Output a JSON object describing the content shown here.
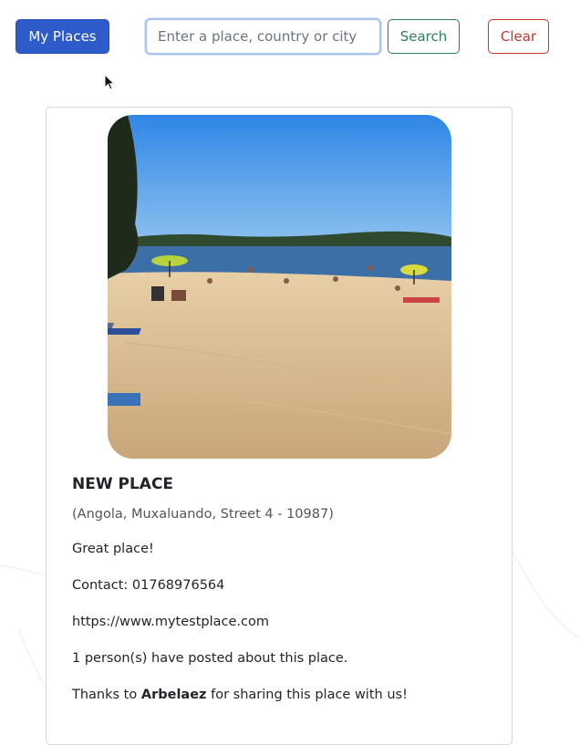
{
  "nav": {
    "my_places_label": "My Places",
    "search_placeholder": "Enter a place, country or city",
    "search_label": "Search",
    "clear_label": "Clear"
  },
  "place": {
    "name": "NEW PLACE",
    "address": "(Angola, Muxaluando, Street 4 - 10987)",
    "description": "Great place!",
    "contact": "Contact: 01768976564",
    "website": "https://www.mytestplace.com",
    "posts": "1 person(s) have posted about this place.",
    "thanks_prefix": "Thanks to",
    "author": "Arbelaez",
    "thanks_suffix": "for sharing this place with us!"
  },
  "colors": {
    "primary": "#2d5bc9",
    "search": "#2e7d5b",
    "clear": "#c0392b"
  },
  "icons": {
    "cursor": "mouse-pointer-icon"
  }
}
